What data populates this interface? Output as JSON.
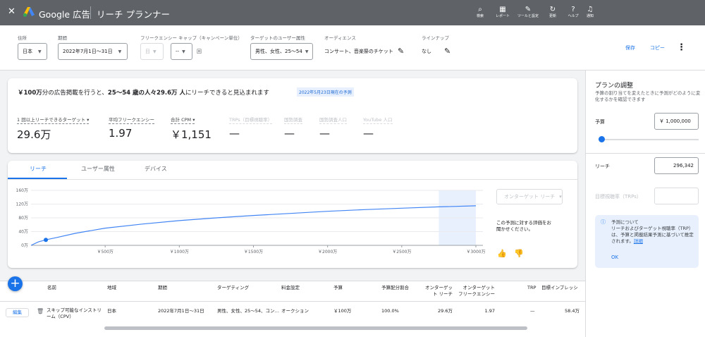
{
  "topbar": {
    "close_icon": "close-icon",
    "brand": "Google 広告",
    "page_title": "リーチ プランナー",
    "tools": [
      {
        "icon": "search-icon",
        "glyph": "⌕",
        "label": "検索"
      },
      {
        "icon": "report-icon",
        "glyph": "▦",
        "label": "レポート"
      },
      {
        "icon": "tools-icon",
        "glyph": "✎",
        "label": "ツールと設定"
      },
      {
        "icon": "refresh-icon",
        "glyph": "↻",
        "label": "更新"
      },
      {
        "icon": "help-icon",
        "glyph": "?",
        "label": "ヘルプ"
      },
      {
        "icon": "bell-icon",
        "glyph": "♫",
        "label": "通知"
      }
    ]
  },
  "filters": {
    "location": {
      "label": "住所",
      "value": "日本"
    },
    "period": {
      "label": "期間",
      "value": "2022年7月1日～31日"
    },
    "frequency_cap": {
      "label": "フリークエンシー キャップ（キャンペーン単位）",
      "value": "目",
      "count": "--",
      "unit": "回"
    },
    "target": {
      "label": "ターゲットのユーザー属性",
      "value": "男性、女性、25～54"
    },
    "audience": {
      "label": "オーディエンス",
      "value": "コンサート、音楽祭のチケット"
    },
    "lineup": {
      "label": "ラインナップ",
      "value": "なし"
    },
    "save": "保存",
    "copy": "コピー"
  },
  "summary": {
    "headline_prefix": "￥100万",
    "headline_mid1": "分の広告掲載を行うと、",
    "headline_bold": "25～54 歳の人々29.6万 人",
    "headline_mid2": "にリーチできると見込まれます",
    "date_badge": "2022年5月23日現在の予測",
    "metrics": [
      {
        "label": "1 回以上リーチできるターゲット ▾",
        "value": "29.6万",
        "enabled": true
      },
      {
        "label": "平均フリークエンシー",
        "value": "1.97",
        "enabled": true
      },
      {
        "label": "合計 CPM ▾",
        "value": "￥1,151",
        "enabled": true
      },
      {
        "label": "TRPs（目標視聴率）",
        "value": "—",
        "enabled": false
      },
      {
        "label": "国勢調査",
        "value": "—",
        "enabled": false
      },
      {
        "label": "国勢調査人口",
        "value": "—",
        "enabled": false
      },
      {
        "label": "YouTube 人口",
        "value": "—",
        "enabled": false
      }
    ]
  },
  "chart_tabs": [
    "リーチ",
    "ユーザー属性",
    "デバイス"
  ],
  "chart_data": {
    "type": "line",
    "y_ticks": [
      "160万",
      "120万",
      "80万",
      "40万",
      "0万"
    ],
    "x_ticks": [
      "￥500万",
      "￥1000万",
      "￥1500万",
      "￥2000万",
      "￥2500万",
      "￥3000万"
    ],
    "xlim": [
      0,
      3000
    ],
    "ylim": [
      0,
      160
    ],
    "series": [
      {
        "points": [
          [
            0,
            0
          ],
          [
            50,
            10
          ],
          [
            100,
            16
          ],
          [
            175,
            23
          ],
          [
            300,
            35
          ],
          [
            500,
            50
          ],
          [
            750,
            62
          ],
          [
            1000,
            72
          ],
          [
            1250,
            80
          ],
          [
            1500,
            87
          ],
          [
            1750,
            93
          ],
          [
            2000,
            99
          ],
          [
            2250,
            104
          ],
          [
            2500,
            108
          ],
          [
            2750,
            112
          ],
          [
            3000,
            115
          ]
        ]
      }
    ],
    "highlight_point": [
      100,
      16
    ],
    "highlight_range": [
      2750,
      3000
    ],
    "grid": true
  },
  "chart_side": {
    "select": "オンターゲット リーチ",
    "feedback": "この予測に対する評価をお聞かせください。",
    "thumbs_up": "👍",
    "thumbs_down": "👎"
  },
  "add_button": "+",
  "table": {
    "headers": [
      "名前",
      "地域",
      "期間",
      "ターゲティング",
      "料金設定",
      "予算",
      "予算配分割合",
      "オンターゲット リーチ",
      "オンターゲット フリークエンシー",
      "TRP",
      "目標インプレッシ"
    ],
    "row": {
      "edit": "編集",
      "name": "スキップ可能なインストリーム（CPV）",
      "region": "日本",
      "period": "2022年7月1日～31日",
      "targeting": "男性、女性、25～54、コン…",
      "pricing": "オークション",
      "budget": "￥100万",
      "share": "100.0%",
      "reach": "29.6万",
      "frequency": "1.97",
      "trp": "—",
      "impressions": "58.4万"
    }
  },
  "panel": {
    "title": "プランの調整",
    "desc": "予算の割り当てを変えたときに予測がどのように変化するかを確認できます",
    "budget_label": "予算",
    "budget_value": "￥ 1,000,000",
    "budget_fraction": 0.03,
    "reach_label": "リーチ",
    "reach_value": "296,342",
    "trp_label": "目標視聴率（TRPs）",
    "info_icon": "ⓘ",
    "info_title": "予測について",
    "info_body": "リーチおよびターゲット視聴率（TRP）は、予算と掲載結果予測に基づいて推定されます。",
    "info_link": "詳細",
    "ok": "OK"
  }
}
